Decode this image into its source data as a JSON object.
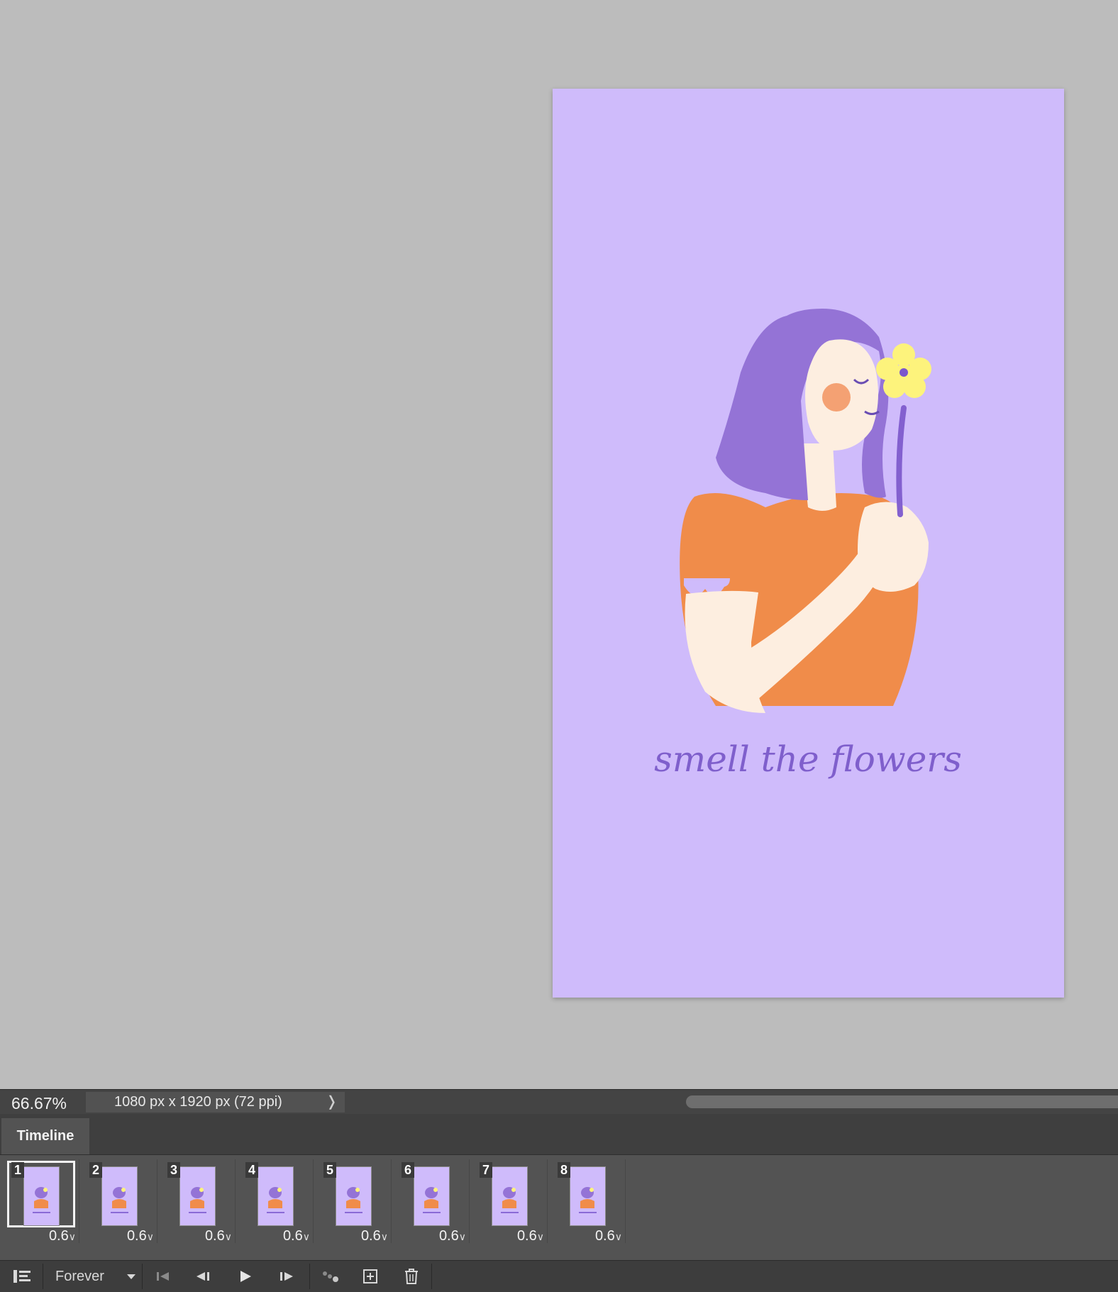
{
  "canvas": {
    "bg_color": "#bcbcbc",
    "artwork": {
      "background_color": "#cfbbfb",
      "caption": "smell the flowers",
      "caption_color": "#7f5fcc"
    }
  },
  "status_bar": {
    "zoom": "66.67%",
    "doc_info": "1080 px x 1920 px (72 ppi)",
    "arrow_icon": "chevron-right-icon"
  },
  "timeline": {
    "tab_label": "Timeline",
    "frames": [
      {
        "number": "1",
        "delay": "0.6"
      },
      {
        "number": "2",
        "delay": "0.6"
      },
      {
        "number": "3",
        "delay": "0.6"
      },
      {
        "number": "4",
        "delay": "0.6"
      },
      {
        "number": "5",
        "delay": "0.6"
      },
      {
        "number": "6",
        "delay": "0.6"
      },
      {
        "number": "7",
        "delay": "0.6"
      },
      {
        "number": "8",
        "delay": "0.6"
      }
    ],
    "selected_frame": 1,
    "loop_option": "Forever",
    "controls": [
      "convert-to-video-timeline-icon",
      "first-frame-icon",
      "previous-frame-icon",
      "play-icon",
      "next-frame-icon",
      "tween-icon",
      "duplicate-frame-icon",
      "delete-frame-icon"
    ]
  }
}
